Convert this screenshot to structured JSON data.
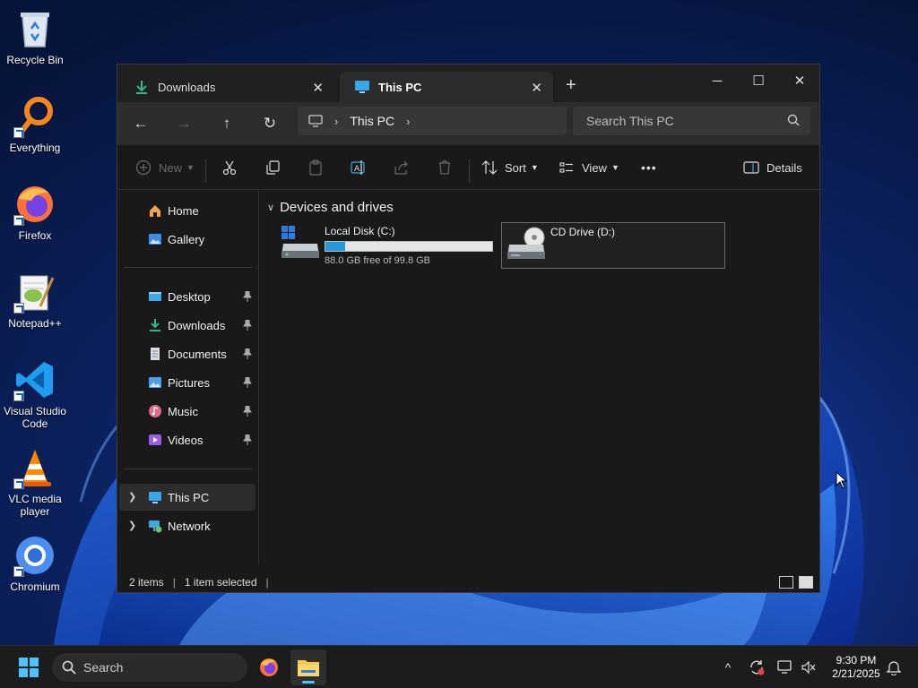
{
  "desktop": {
    "icons": [
      {
        "label": "Recycle Bin",
        "icon": "recycle-bin-icon"
      },
      {
        "label": "Everything",
        "icon": "everything-search-icon"
      },
      {
        "label": "Firefox",
        "icon": "firefox-icon"
      },
      {
        "label": "Notepad++",
        "icon": "notepad-plus-plus-icon"
      },
      {
        "label": "Visual Studio Code",
        "icon": "vscode-icon"
      },
      {
        "label": "VLC media player",
        "icon": "vlc-icon"
      },
      {
        "label": "Chromium",
        "icon": "chromium-icon"
      }
    ]
  },
  "window": {
    "tabs": [
      {
        "label": "Downloads",
        "active": false,
        "icon": "download-arrow-icon"
      },
      {
        "label": "This PC",
        "active": true,
        "icon": "monitor-icon"
      }
    ],
    "new_tab": "+",
    "controls": {
      "minimize": "─",
      "maximize": "☐",
      "close": "✕"
    }
  },
  "nav": {
    "back": "←",
    "forward": "→",
    "up": "↑",
    "refresh": "↻",
    "address": {
      "location": "This PC",
      "sep": "›"
    },
    "search_placeholder": "Search This PC"
  },
  "command_bar": {
    "new": "New",
    "sort": "Sort",
    "view": "View",
    "more": "•••",
    "details": "Details"
  },
  "sidebar": {
    "items": [
      {
        "label": "Home",
        "icon": "home-icon",
        "pinned": false
      },
      {
        "label": "Gallery",
        "icon": "gallery-icon",
        "pinned": false
      },
      {
        "label": "Desktop",
        "icon": "desktop-folder-icon",
        "pinned": true
      },
      {
        "label": "Downloads",
        "icon": "downloads-folder-icon",
        "pinned": true
      },
      {
        "label": "Documents",
        "icon": "documents-folder-icon",
        "pinned": true
      },
      {
        "label": "Pictures",
        "icon": "pictures-folder-icon",
        "pinned": true
      },
      {
        "label": "Music",
        "icon": "music-folder-icon",
        "pinned": true
      },
      {
        "label": "Videos",
        "icon": "videos-folder-icon",
        "pinned": true
      },
      {
        "label": "This PC",
        "icon": "this-pc-icon",
        "selected": true
      },
      {
        "label": "Network",
        "icon": "network-icon"
      }
    ]
  },
  "content": {
    "group_title": "Devices and drives",
    "drives": [
      {
        "name": "Local Disk (C:)",
        "free_text": "88.0 GB free of 99.8 GB",
        "used_fraction": 0.118,
        "selected": false
      },
      {
        "name": "CD Drive (D:)",
        "selected": true
      }
    ]
  },
  "status": {
    "items": "2 items",
    "selected": "1 item selected",
    "caret": "|"
  },
  "taskbar": {
    "search_placeholder": "Search",
    "time": "9:30 PM",
    "date": "2/21/2025",
    "tray_chevron": "^"
  },
  "colors": {
    "accent": "#4cc2ff",
    "drive_bar": "#2699d8",
    "window_bg": "#191919",
    "taskbar_bg": "#1c1c1c"
  }
}
